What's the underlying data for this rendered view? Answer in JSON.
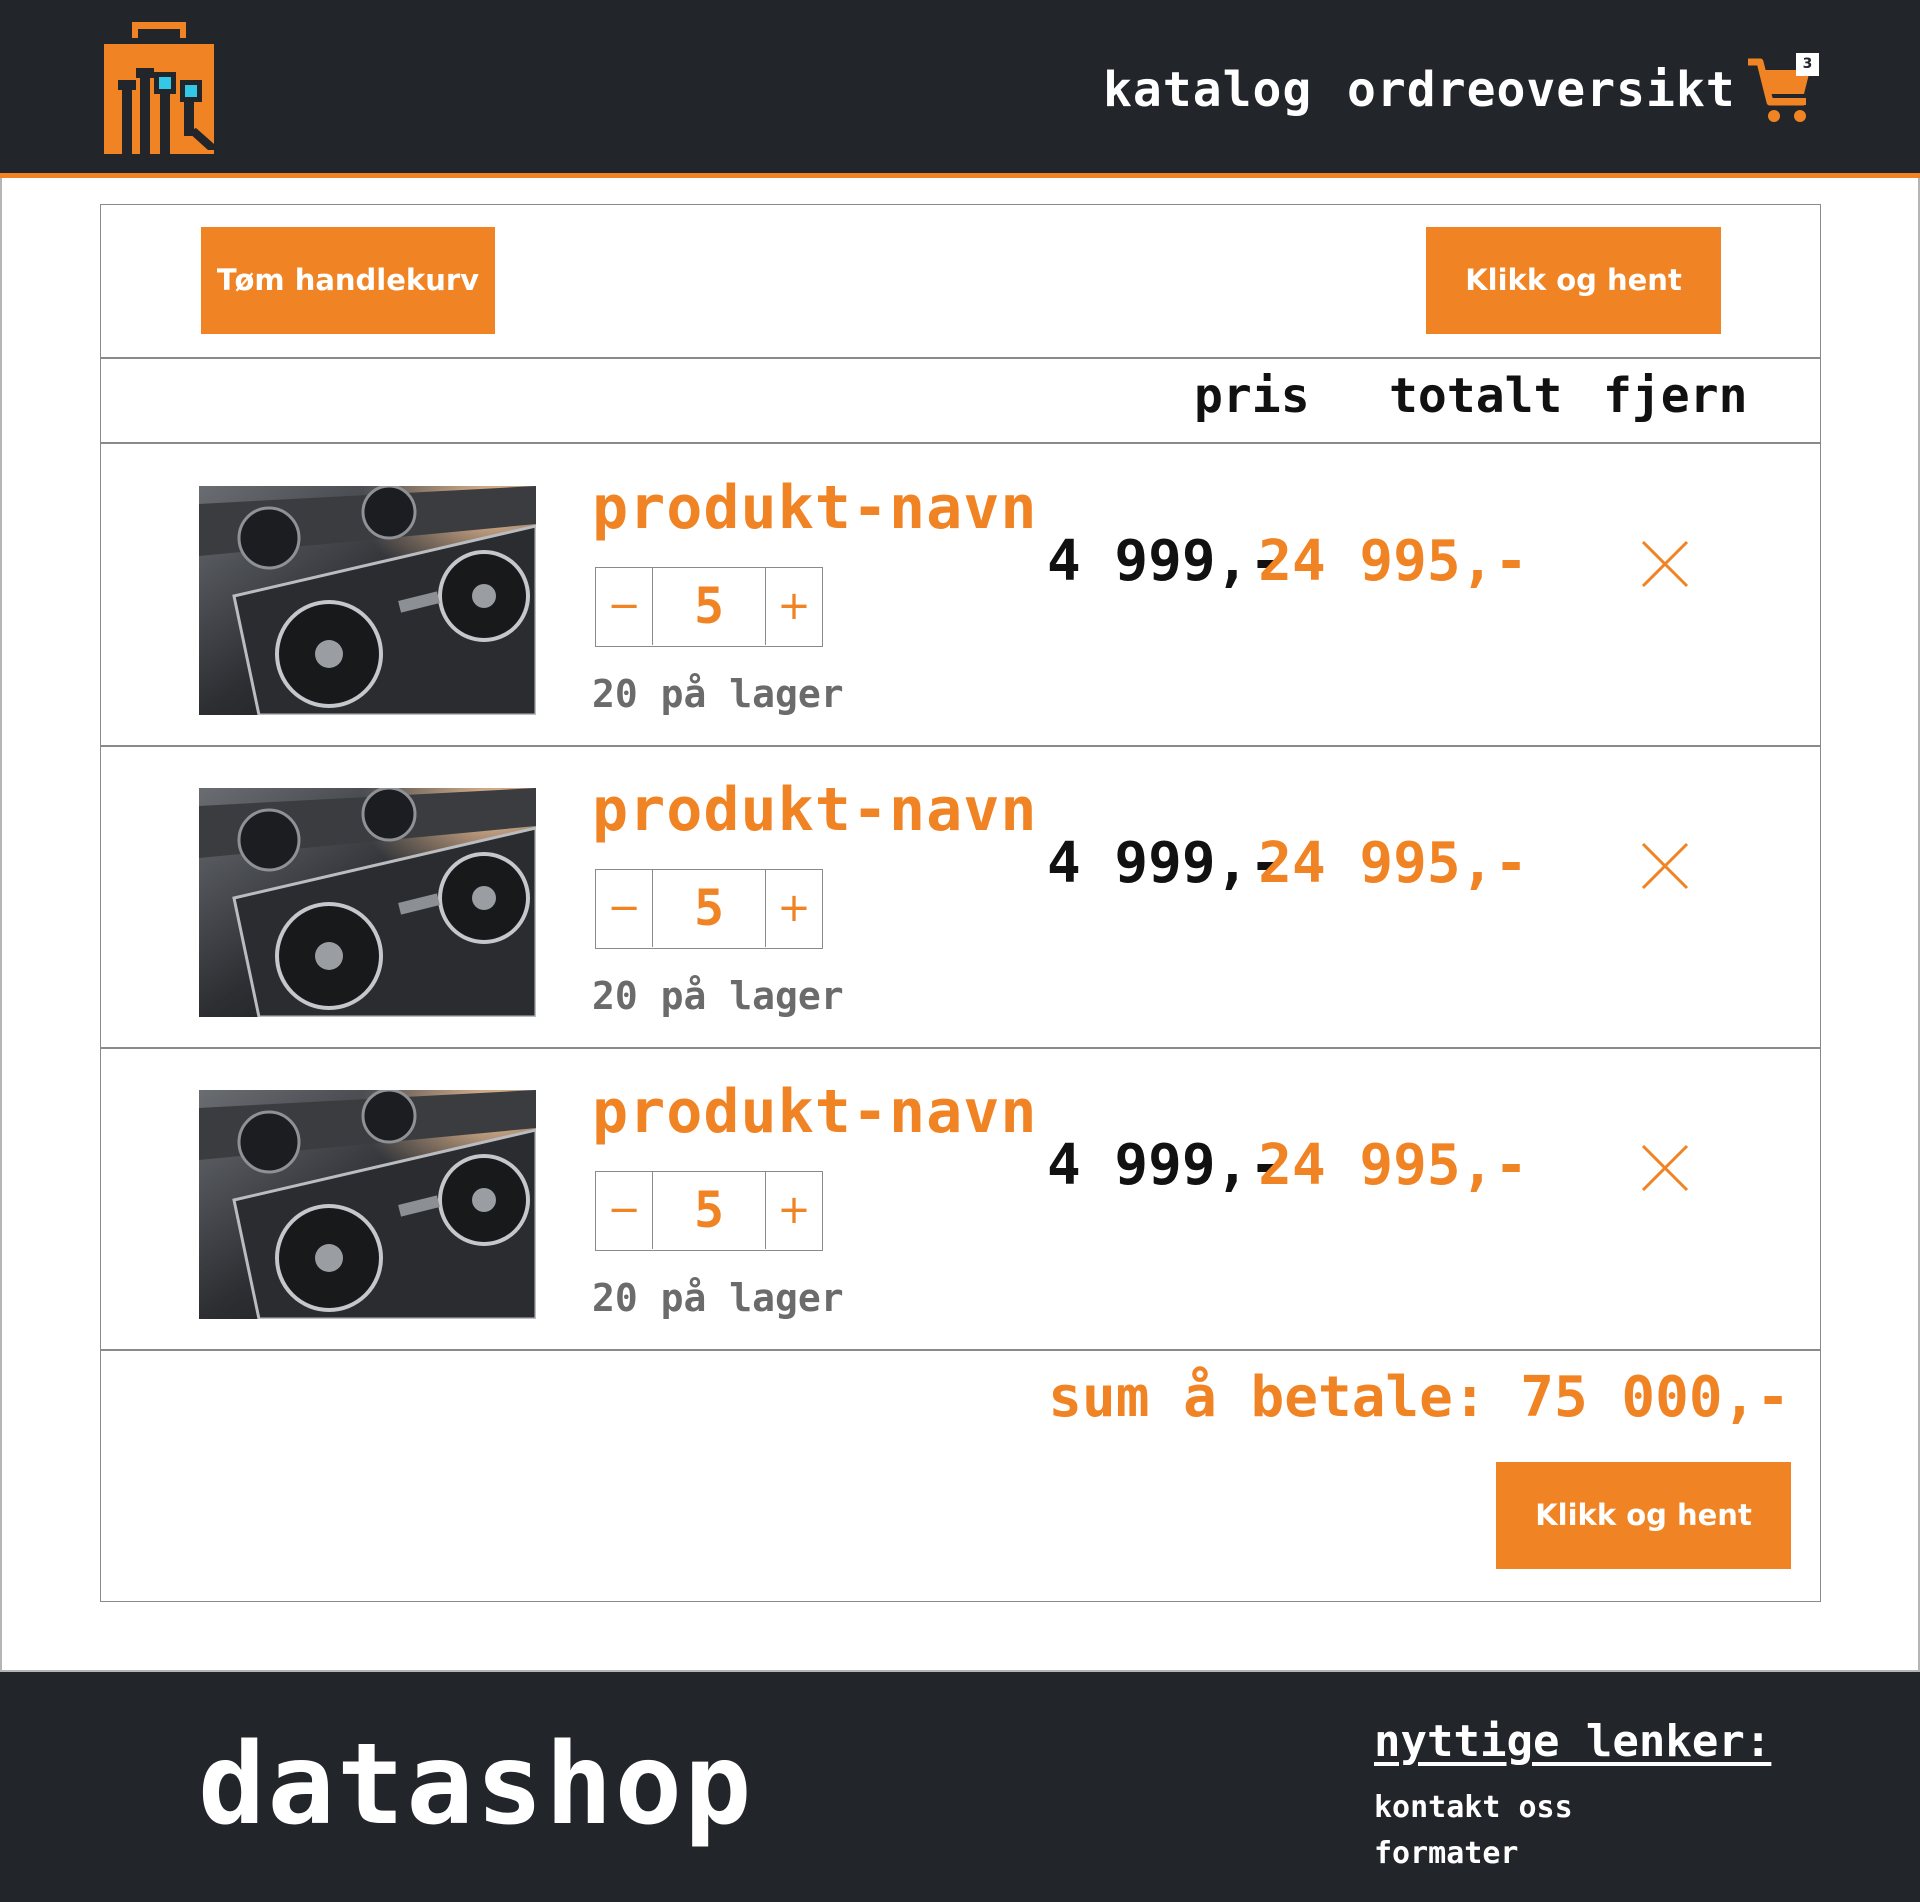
{
  "header": {
    "logo_icon": "shopping-bag-circuit-logo",
    "nav": [
      {
        "label": "katalog"
      },
      {
        "label": "ordreoversikt"
      }
    ],
    "cart_icon": "cart-icon",
    "cart_count": "3"
  },
  "toolbar": {
    "empty_cart_label": "Tøm handlekurv",
    "pickup_label": "Klikk og hent"
  },
  "columns": {
    "price": "pris",
    "total": "totalt",
    "remove": "fjern"
  },
  "items": [
    {
      "name": "produkt-navn",
      "quantity": "5",
      "stock": "20 på lager",
      "price": "4 999,-",
      "total": "24 995,-",
      "remove_icon": "close-icon"
    },
    {
      "name": "produkt-navn",
      "quantity": "5",
      "stock": "20 på lager",
      "price": "4 999,-",
      "total": "24 995,-",
      "remove_icon": "close-icon"
    },
    {
      "name": "produkt-navn",
      "quantity": "5",
      "stock": "20 på lager",
      "price": "4 999,-",
      "total": "24 995,-",
      "remove_icon": "close-icon"
    }
  ],
  "stepper": {
    "minus": "−",
    "plus": "+"
  },
  "summary": {
    "sum_text": "sum å betale: 75 000,-",
    "pickup_label": "Klikk og hent"
  },
  "footer": {
    "brand": "datashop",
    "links_title": "nyttige lenker:",
    "links": [
      "kontakt oss",
      "formater"
    ]
  },
  "colors": {
    "accent": "#f08323",
    "dark": "#22252a",
    "stock_text": "#6b6b6b"
  }
}
